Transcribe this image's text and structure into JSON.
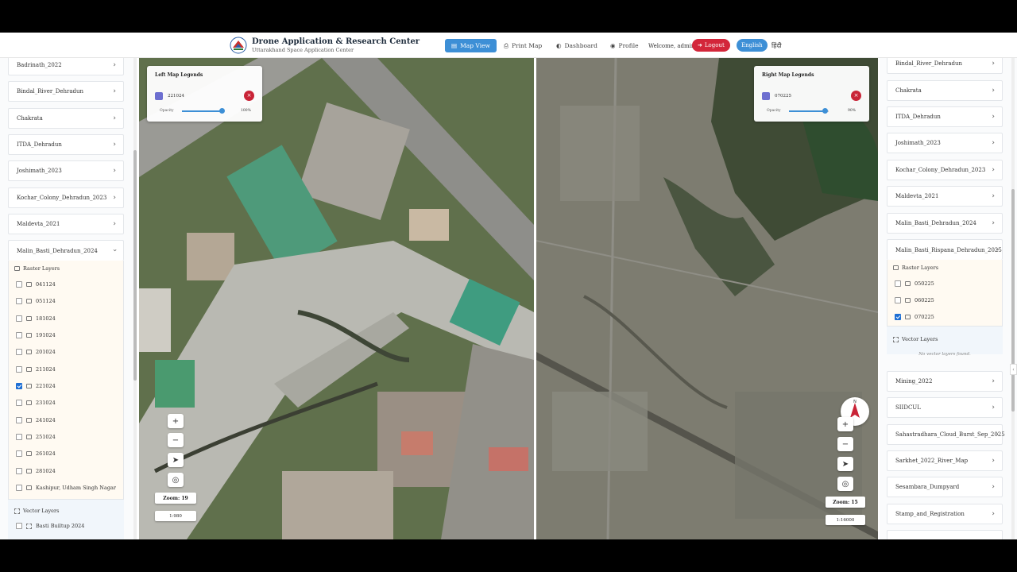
{
  "header": {
    "title": "Drone Application & Research Center",
    "subtitle": "Uttarakhand Space Application Center",
    "nav": [
      {
        "label": "Map View",
        "icon": "map-icon",
        "active": true
      },
      {
        "label": "Print Map",
        "icon": "printer-icon",
        "active": false
      },
      {
        "label": "Dashboard",
        "icon": "dashboard-icon",
        "active": false
      },
      {
        "label": "Profile",
        "icon": "user-icon",
        "active": false
      }
    ],
    "welcome": "Welcome, admin",
    "logout": "Logout",
    "lang_en": "English",
    "lang_hi": "हिंदी"
  },
  "left_sidebar": {
    "projects_top": [
      "Badrinath_2022",
      "Bindal_River_Dehradun",
      "Chakrata",
      "ITDA_Dehradun",
      "Joshimath_2023",
      "Kochar_Colony_Dehradun_2023",
      "Maldevta_2021"
    ],
    "expanded_project": "Malin_Basti_Dehradun_2024",
    "raster_title": "Raster Layers",
    "raster_layers": [
      {
        "name": "041124",
        "checked": false
      },
      {
        "name": "051124",
        "checked": false
      },
      {
        "name": "181024",
        "checked": false
      },
      {
        "name": "191024",
        "checked": false
      },
      {
        "name": "201024",
        "checked": false
      },
      {
        "name": "211024",
        "checked": false
      },
      {
        "name": "221024",
        "checked": true
      },
      {
        "name": "231024",
        "checked": false
      },
      {
        "name": "241024",
        "checked": false
      },
      {
        "name": "251024",
        "checked": false
      },
      {
        "name": "261024",
        "checked": false
      },
      {
        "name": "281024",
        "checked": false
      },
      {
        "name": "Kashipur, Udham Singh Nagar",
        "checked": false
      }
    ],
    "vector_title": "Vector Layers",
    "vector_layers": [
      {
        "name": "Basti Builtup 2024",
        "checked": false
      }
    ]
  },
  "right_sidebar": {
    "projects_top": [
      "Bindal_River_Dehradun",
      "Chakrata",
      "ITDA_Dehradun",
      "Joshimath_2023",
      "Kochar_Colony_Dehradun_2023",
      "Maldevta_2021",
      "Malin_Basti_Dehradun_2024"
    ],
    "expanded_project": "Malin_Basti_Rispana_Dehradun_2025",
    "raster_title": "Raster Layers",
    "raster_layers": [
      {
        "name": "050225",
        "checked": false
      },
      {
        "name": "060225",
        "checked": false
      },
      {
        "name": "070225",
        "checked": true
      }
    ],
    "vector_title": "Vector Layers",
    "no_vector": "No vector layers found.",
    "projects_bottom": [
      "Mining_2022",
      "SIIDCUL",
      "Sahastradhara_Cloud_Burst_Sep_2025",
      "Sarkhet_2022_River_Map",
      "Sesambara_Dumpyard",
      "Stamp_and_Registration"
    ]
  },
  "left_map": {
    "legend_title": "Left Map Legends",
    "layer": "221024",
    "opacity_label": "Opacity",
    "opacity_value": "100%",
    "opacity_fraction": 1.0,
    "zoom": "Zoom: 19",
    "scale": "1:980"
  },
  "right_map": {
    "legend_title": "Right Map Legends",
    "layer": "070225",
    "opacity_label": "Opacity",
    "opacity_value": "90%",
    "opacity_fraction": 0.9,
    "zoom": "Zoom: 15",
    "scale": "1:16000"
  },
  "colors": {
    "primary": "#3d8fd6",
    "danger": "#d3263a",
    "legend_swatch": "#6d6fd0"
  }
}
